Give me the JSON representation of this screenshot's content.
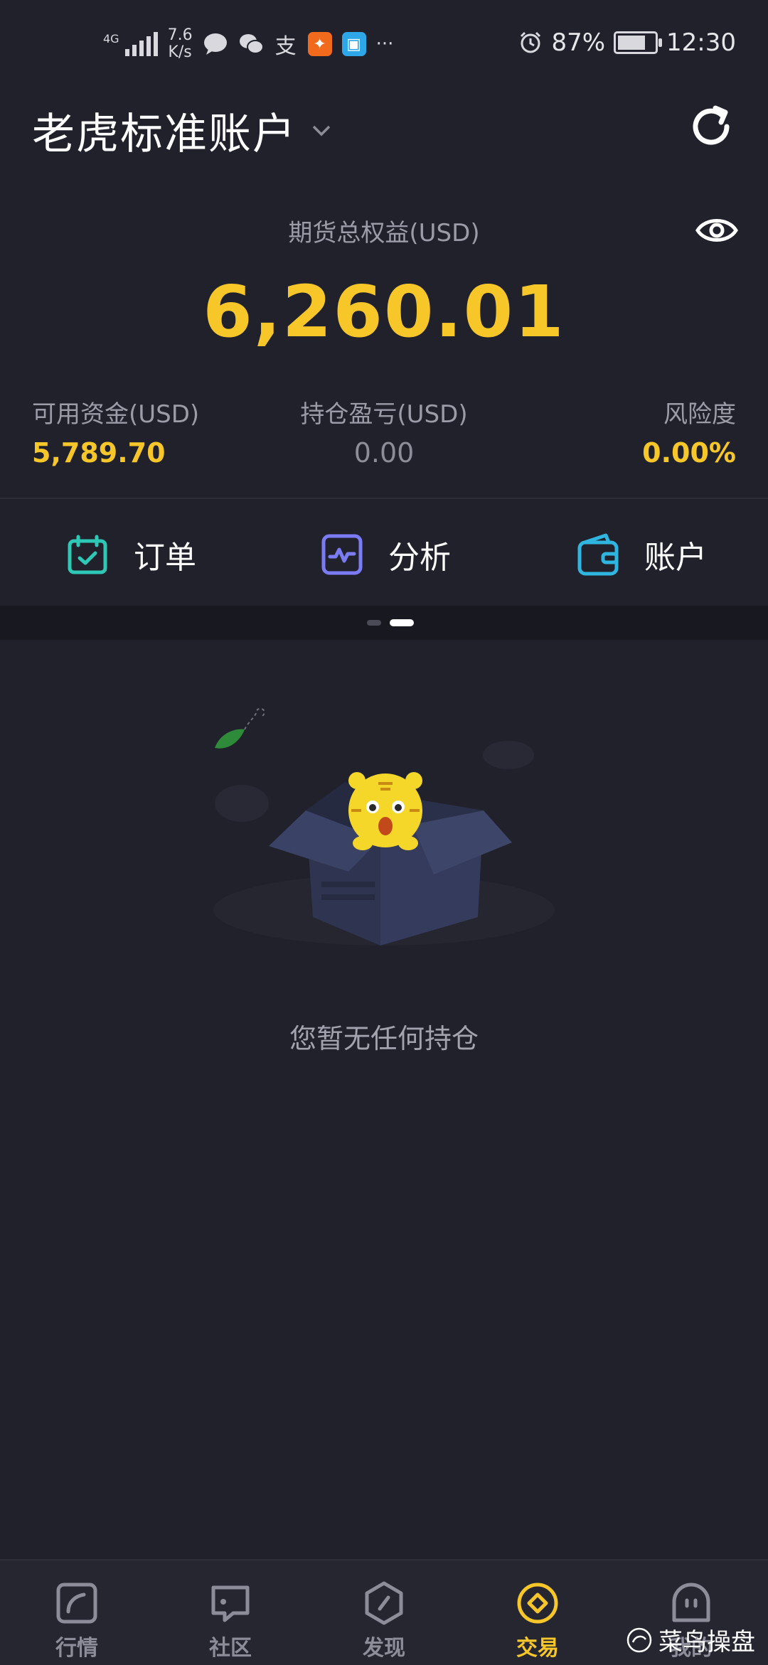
{
  "status_bar": {
    "network": "4G",
    "net_speed_value": "7.6",
    "net_speed_unit": "K/s",
    "battery": "87%",
    "battery_level": 0.87,
    "time": "12:30",
    "more": "···"
  },
  "header": {
    "account_title": "老虎标准账户"
  },
  "summary": {
    "equity_label": "期货总权益(USD)",
    "equity_value": "6,260.01",
    "stats": [
      {
        "label": "可用资金(USD)",
        "value": "5,789.70"
      },
      {
        "label": "持仓盈亏(USD)",
        "value": "0.00"
      },
      {
        "label": "风险度",
        "value": "0.00%"
      }
    ]
  },
  "actions": [
    {
      "label": "订单",
      "icon": "calendar-check-icon",
      "color": "#2ec9b6"
    },
    {
      "label": "分析",
      "icon": "pulse-chart-icon",
      "color": "#7b7cf3"
    },
    {
      "label": "账户",
      "icon": "wallet-icon",
      "color": "#2fb6e0"
    }
  ],
  "pager": {
    "pages": 2,
    "current": 2
  },
  "empty_state": {
    "message": "您暂无任何持仓",
    "illustration": "tiger-in-box"
  },
  "bottom_nav": {
    "tabs": [
      {
        "label": "行情",
        "icon": "chart-icon"
      },
      {
        "label": "社区",
        "icon": "chat-icon"
      },
      {
        "label": "发现",
        "icon": "compass-icon"
      },
      {
        "label": "交易",
        "icon": "trade-icon",
        "active": true
      },
      {
        "label": "我的",
        "icon": "profile-icon"
      }
    ]
  },
  "watermark": "菜鸟操盘",
  "colors": {
    "background": "#21212b",
    "accent_yellow": "#f7c72a",
    "muted_text": "#9b9ca8"
  }
}
